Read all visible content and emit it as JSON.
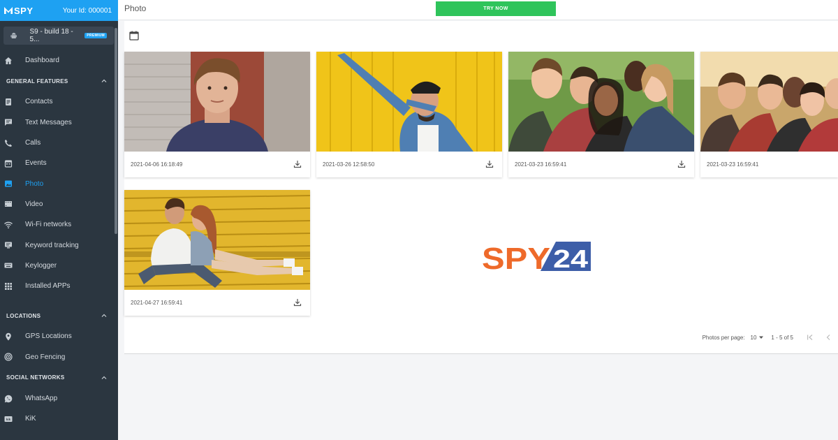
{
  "brand": {
    "logo_text": "SPY",
    "user_id": "Your Id: 000001"
  },
  "device": {
    "name": "S9 - build 18 - 5...",
    "badge": "PREMIUM"
  },
  "nav": {
    "dashboard": "Dashboard",
    "general_features": {
      "title": "GENERAL FEATURES",
      "items": [
        "Contacts",
        "Text Messages",
        "Calls",
        "Events",
        "Photo",
        "Video",
        "Wi-Fi networks",
        "Keyword tracking",
        "Keylogger",
        "Installed APPs"
      ]
    },
    "locations": {
      "title": "LOCATIONS",
      "items": [
        "GPS Locations",
        "Geo Fencing"
      ]
    },
    "social_networks": {
      "title": "SOCIAL NETWORKS",
      "items": [
        "WhatsApp",
        "KiK"
      ]
    },
    "active_item": "Photo"
  },
  "header": {
    "title": "Photo",
    "try_now": "TRY NOW"
  },
  "photos": [
    {
      "timestamp": "2021-04-06 16:18:49"
    },
    {
      "timestamp": "2021-03-26 12:58:50"
    },
    {
      "timestamp": "2021-03-23 16:59:41"
    },
    {
      "timestamp": "2021-03-23 16:59:41"
    },
    {
      "timestamp": "2021-04-27 16:59:41"
    }
  ],
  "watermark": {
    "left": "SPY",
    "right": "24"
  },
  "pagination": {
    "label": "Photos per page:",
    "per_page": "10",
    "range": "1 - 5 of 5"
  },
  "colors": {
    "accent": "#1ea1f2",
    "sidebar": "#2b3640",
    "try_now": "#2fc45b",
    "spy_orange": "#ee6a2a",
    "spy_blue": "#3d5ea8"
  }
}
